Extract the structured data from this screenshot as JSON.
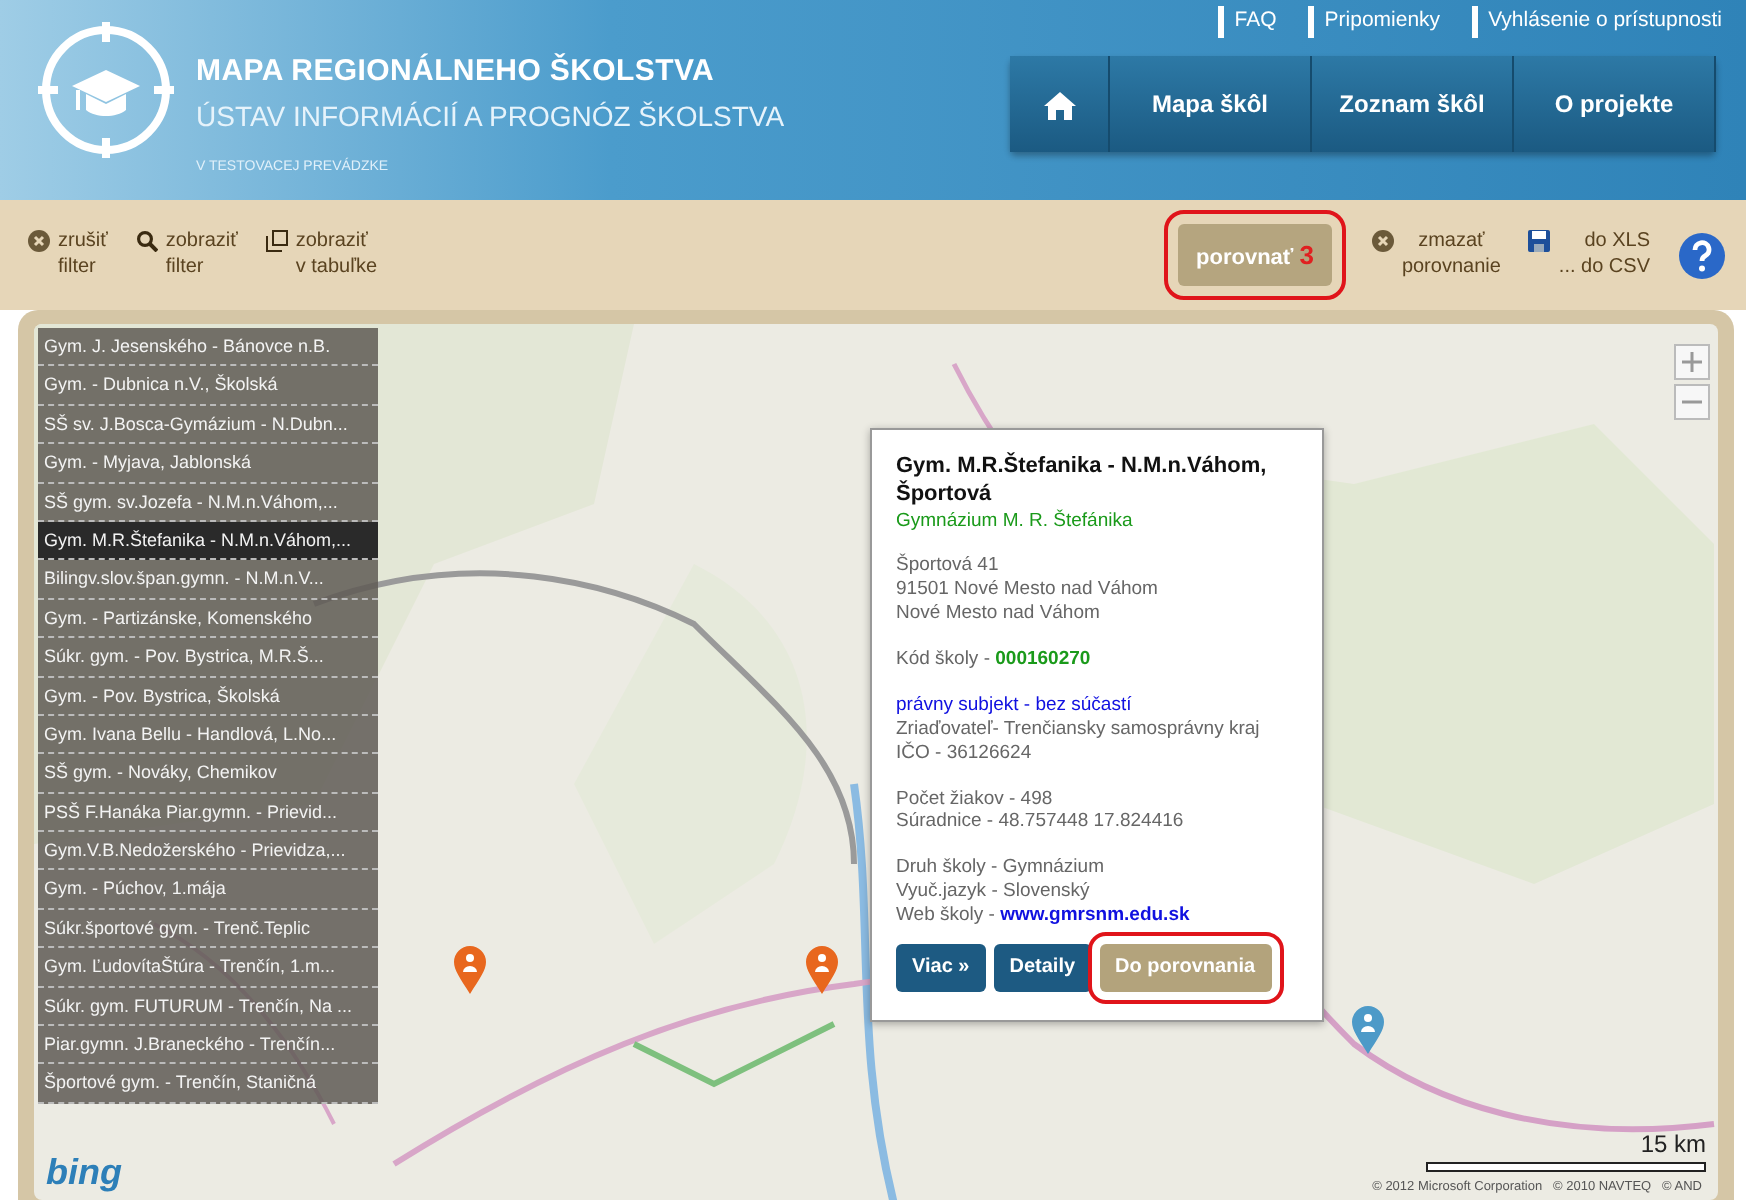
{
  "header": {
    "title": "MAPA REGIONÁLNEHO ŠKOLSTVA",
    "subtitle": "ÚSTAV INFORMÁCIÍ A PROGNÓZ ŠKOLSTVA",
    "tagline": "V TESTOVACEJ PREVÁDZKE",
    "top_links": [
      "FAQ",
      "Pripomienky",
      "Vyhlásenie o prístupnosti"
    ],
    "nav": [
      {
        "kind": "home"
      },
      {
        "kind": "text",
        "label": "Mapa škôl"
      },
      {
        "kind": "text",
        "label": "Zoznam škôl"
      },
      {
        "kind": "text",
        "label": "O projekte"
      }
    ]
  },
  "toolbar": {
    "actions": [
      {
        "kind": "clear",
        "label": "zrušiť\nfilter"
      },
      {
        "kind": "search",
        "label": "zobraziť\nfilter"
      },
      {
        "kind": "table",
        "label": "zobraziť\nv tabuľke"
      }
    ],
    "compare": {
      "label": "porovnať",
      "count": "3",
      "highlighted": true
    },
    "clear_compare": "zmazať\nporovnanie",
    "export": [
      "do XLS",
      "... do CSV"
    ]
  },
  "schools": [
    {
      "label": "Gym. J. Jesenského - Bánovce n.B.",
      "selected": false
    },
    {
      "label": "Gym. - Dubnica n.V., Školská",
      "selected": false
    },
    {
      "label": "SŠ sv. J.Bosca-Gymázium - N.Dubn...",
      "selected": false
    },
    {
      "label": "Gym. - Myjava, Jablonská",
      "selected": false
    },
    {
      "label": "SŠ gym. sv.Jozefa - N.M.n.Váhom,...",
      "selected": false
    },
    {
      "label": "Gym. M.R.Štefanika - N.M.n.Váhom,...",
      "selected": true
    },
    {
      "label": "Bilingv.slov.špan.gymn. - N.M.n.V...",
      "selected": false
    },
    {
      "label": "Gym. - Partizánske, Komenského",
      "selected": false
    },
    {
      "label": "Súkr. gym. - Pov. Bystrica, M.R.Š...",
      "selected": false
    },
    {
      "label": "Gym. - Pov. Bystrica, Školská",
      "selected": false
    },
    {
      "label": "Gym. Ivana Bellu - Handlová, L.No...",
      "selected": false
    },
    {
      "label": "SŠ gym. - Nováky, Chemikov",
      "selected": false
    },
    {
      "label": "PSŠ F.Hanáka Piar.gymn. - Prievid...",
      "selected": false
    },
    {
      "label": "Gym.V.B.Nedožerského - Prievidza,...",
      "selected": false
    },
    {
      "label": "Gym. - Púchov, 1.mája",
      "selected": false
    },
    {
      "label": "Súkr.športové gym. - Trenč.Teplic",
      "selected": false
    },
    {
      "label": "Gym. ĽudovítaŠtúra - Trenčín, 1.m...",
      "selected": false
    },
    {
      "label": "Súkr. gym. FUTURUM - Trenčín, Na ...",
      "selected": false
    },
    {
      "label": "Piar.gymn. J.Braneckého - Trenčín...",
      "selected": false
    },
    {
      "label": "Športové gym. - Trenčín, Staničná",
      "selected": false
    }
  ],
  "popup": {
    "title": "Gym. M.R.Štefanika - N.M.n.Váhom, Športová",
    "name": "Gymnázium M. R. Štefánika",
    "address": [
      "Športová 41",
      "91501 Nové Mesto nad Váhom",
      "Nové Mesto nad Váhom"
    ],
    "code_label": "Kód školy - ",
    "code": "000160270",
    "legal": "právny subjekt - bez súčastí",
    "founder": [
      "Zriaďovateľ- Trenčiansky samosprávny kraj",
      "IČO - 36126624"
    ],
    "stats": [
      "Počet žiakov - 498",
      "Súradnice - 48.757448 17.824416"
    ],
    "info": [
      "Druh školy - Gymnázium",
      "Vyuč.jazyk - Slovenský"
    ],
    "web_label": "Web školy - ",
    "web": "www.gmrsnm.edu.sk",
    "buttons": [
      {
        "kind": "primary",
        "label": "Viac »"
      },
      {
        "kind": "primary",
        "label": "Detaily"
      },
      {
        "kind": "compare",
        "label": "Do porovnania",
        "highlighted": true
      }
    ]
  },
  "map": {
    "scale": "15 km",
    "copyright": "© 2012 Microsoft Corporation   © 2010 NAVTEQ   © AND",
    "provider": "bing"
  }
}
